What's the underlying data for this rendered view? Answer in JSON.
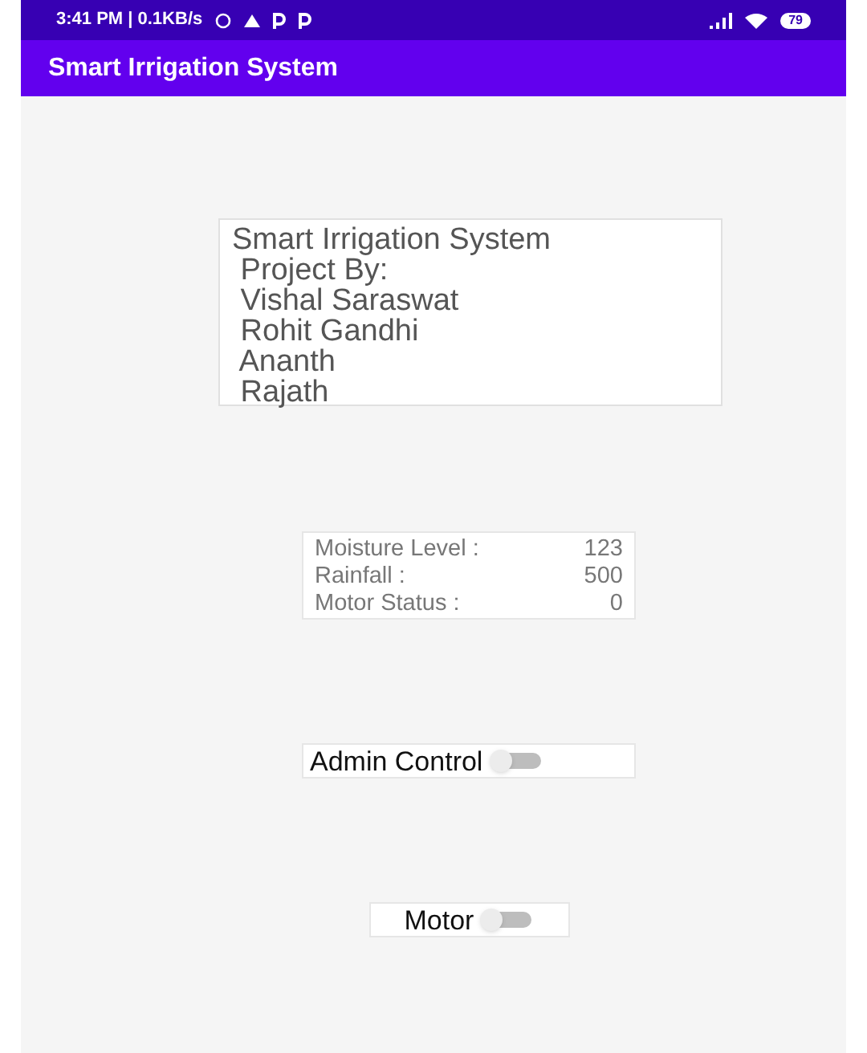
{
  "status_bar": {
    "time": "3:41 PM | 0.1KB/s",
    "battery": "79"
  },
  "app_bar": {
    "title": "Smart Irrigation System"
  },
  "project_box": {
    "lines": [
      "Smart Irrigation System",
      " Project By:",
      " Vishal Saraswat",
      " Rohit Gandhi",
      " Ananth",
      " Rajath"
    ]
  },
  "readings": [
    {
      "label": "Moisture Level :",
      "value": "123"
    },
    {
      "label": "Rainfall :",
      "value": "500"
    },
    {
      "label": "Motor Status :",
      "value": "0"
    }
  ],
  "switches": [
    {
      "label": "Admin Control",
      "on": false
    },
    {
      "label": "Motor",
      "on": false
    }
  ]
}
